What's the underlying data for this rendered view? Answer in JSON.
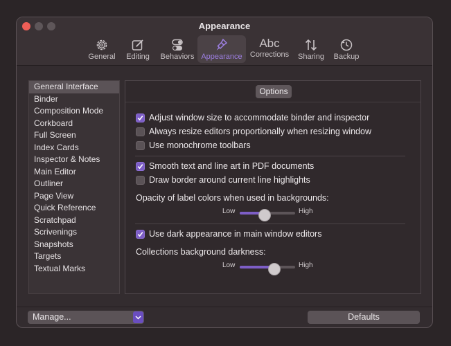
{
  "window": {
    "title": "Appearance"
  },
  "toolbar": {
    "items": [
      {
        "label": "General",
        "icon": "gear-icon"
      },
      {
        "label": "Editing",
        "icon": "edit-icon"
      },
      {
        "label": "Behaviors",
        "icon": "toggles-icon"
      },
      {
        "label": "Appearance",
        "icon": "brush-icon",
        "active": true
      },
      {
        "label": "Corrections",
        "icon": "abc-icon",
        "glyph": "Abc"
      },
      {
        "label": "Sharing",
        "icon": "up-down-arrows-icon"
      },
      {
        "label": "Backup",
        "icon": "backup-clock-icon"
      }
    ]
  },
  "sidebar": {
    "items": [
      {
        "label": "General Interface",
        "selected": true
      },
      {
        "label": "Binder"
      },
      {
        "label": "Composition Mode"
      },
      {
        "label": "Corkboard"
      },
      {
        "label": "Full Screen"
      },
      {
        "label": "Index Cards"
      },
      {
        "label": "Inspector & Notes"
      },
      {
        "label": "Main Editor"
      },
      {
        "label": "Outliner"
      },
      {
        "label": "Page View"
      },
      {
        "label": "Quick Reference"
      },
      {
        "label": "Scratchpad"
      },
      {
        "label": "Scrivenings"
      },
      {
        "label": "Snapshots"
      },
      {
        "label": "Targets"
      },
      {
        "label": "Textual Marks"
      }
    ]
  },
  "panel": {
    "tab": "Options",
    "options": [
      {
        "label": "Adjust window size to accommodate binder and inspector",
        "checked": true
      },
      {
        "label": "Always resize editors proportionally when resizing window",
        "checked": false
      },
      {
        "label": "Use monochrome toolbars",
        "checked": false
      },
      {
        "label": "Smooth text and line art in PDF documents",
        "checked": true
      },
      {
        "label": "Draw border around current line highlights",
        "checked": false
      },
      {
        "label": "Use dark appearance in main window editors",
        "checked": true
      }
    ],
    "opacity": {
      "label": "Opacity of label colors when used in backgrounds:",
      "low": "Low",
      "high": "High",
      "value": 0.45
    },
    "darkness": {
      "label": "Collections background darkness:",
      "low": "Low",
      "high": "High",
      "value": 0.63
    }
  },
  "footer": {
    "manage": "Manage...",
    "defaults": "Defaults"
  },
  "colors": {
    "accent": "#7d5ec6",
    "close": "#ee5e57"
  }
}
